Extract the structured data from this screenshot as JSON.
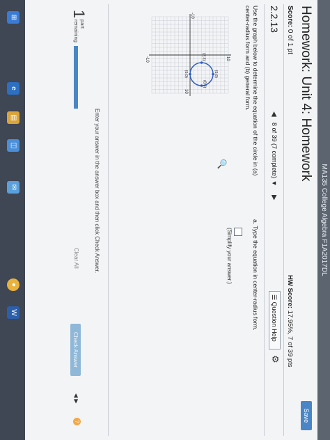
{
  "window": {
    "title": "MA135 College Algebra F1A2017DL"
  },
  "header": {
    "title": "Homework: Unit 4: Homework",
    "save_label": "Save",
    "score_label": "Score:",
    "score_value": "0 of 1 pt",
    "hw_score_label": "HW Score:",
    "hw_score_value": "17.95%, 7 of 39 pts"
  },
  "question": {
    "number": "2.2.13",
    "nav_position": "8 of 39 (7 complete)",
    "help_label": "Question Help",
    "prompt": "Use the graph below to determine the equation of the circle in (a) center-radius form and (b) general form.",
    "part_a": "a. Type the equation in center-radius form.",
    "simplify_hint": "(Simplify your answer.)"
  },
  "graph": {
    "x_min_label": "-10",
    "x_max_label": "10",
    "y_max_label": "10",
    "y_min_label": "-10",
    "points": [
      {
        "label": "(5,6)",
        "x": 5,
        "y": 6
      },
      {
        "label": "(2,3)",
        "x": 2,
        "y": 3
      },
      {
        "label": "(8,3)",
        "x": 8,
        "y": 3
      },
      {
        "label": "(5,0)",
        "x": 5,
        "y": 0
      }
    ],
    "center": {
      "x": 5,
      "y": 3
    },
    "radius": 3,
    "range": [
      -10,
      10
    ],
    "colors": {
      "circle": "#2f5fc4",
      "grid": "#c7ccd3",
      "axis": "#333333"
    }
  },
  "footer": {
    "instructions": "Enter your answer in the answer box and then click Check Answer.",
    "parts_count": "1",
    "parts_label_1": "part",
    "parts_label_2": "remaining",
    "progress_fraction": 0.0,
    "clear_all": "Clear All",
    "check_answer": "Check Answer",
    "help": "?"
  },
  "taskbar": {
    "icons": [
      "windows-icon",
      "edge-icon",
      "file-explorer-icon",
      "store-icon",
      "mail-icon",
      "chrome-icon",
      "word-icon"
    ]
  }
}
